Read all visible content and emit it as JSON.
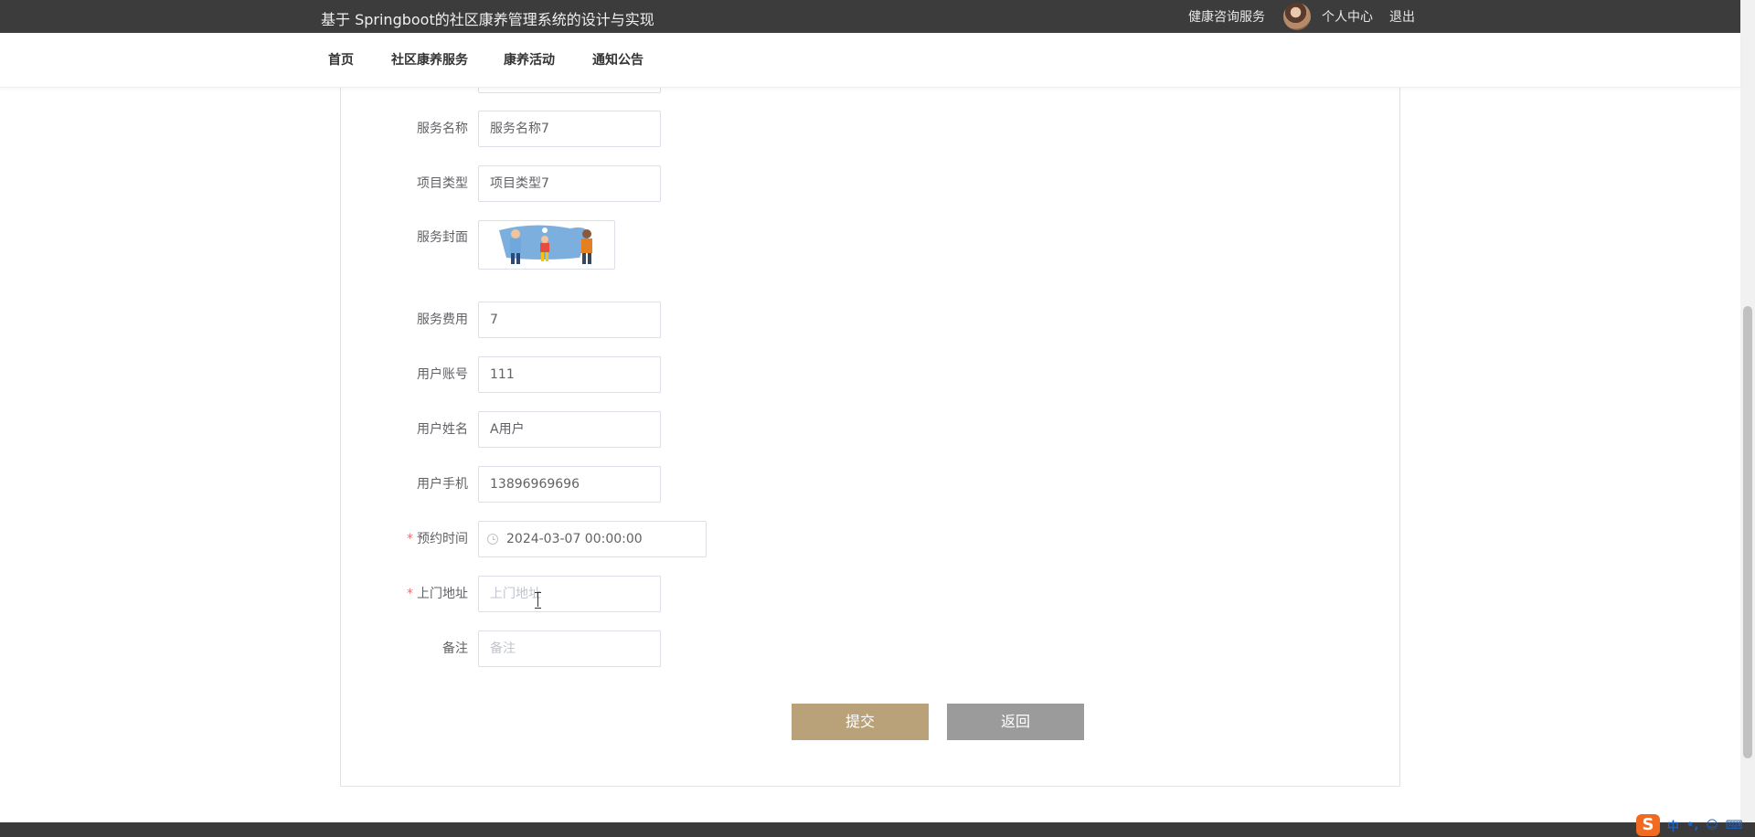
{
  "header": {
    "site_title": "基于 Springboot的社区康养管理系统的设计与实现",
    "links": {
      "health_consult": "健康咨询服务",
      "profile": "个人中心",
      "logout": "退出"
    }
  },
  "nav": {
    "items": [
      "首页",
      "社区康养服务",
      "康养活动",
      "通知公告"
    ]
  },
  "form": {
    "service_name": {
      "label": "服务名称",
      "value": "服务名称7"
    },
    "project_type": {
      "label": "项目类型",
      "value": "项目类型7"
    },
    "cover": {
      "label": "服务封面"
    },
    "fee": {
      "label": "服务费用",
      "value": "7"
    },
    "user_account": {
      "label": "用户账号",
      "value": "111"
    },
    "user_name": {
      "label": "用户姓名",
      "value": "A用户"
    },
    "user_phone": {
      "label": "用户手机",
      "value": "13896969696"
    },
    "appointment_time": {
      "label": "预约时间",
      "value": "2024-03-07 00:00:00",
      "required_mark": "*"
    },
    "address": {
      "label": "上门地址",
      "placeholder": "上门地址",
      "required_mark": "*"
    },
    "remark": {
      "label": "备注",
      "placeholder": "备注"
    }
  },
  "buttons": {
    "submit": "提交",
    "back": "返回"
  },
  "ime": {
    "logo": "S",
    "mode": "中",
    "punct": "•,",
    "emoji": "☺",
    "keyboard": "⌨"
  },
  "colors": {
    "topbar": "#3c3c3c",
    "submit_button": "#b9a27a",
    "back_button": "#9b9b9b",
    "required": "#f56c6c"
  }
}
